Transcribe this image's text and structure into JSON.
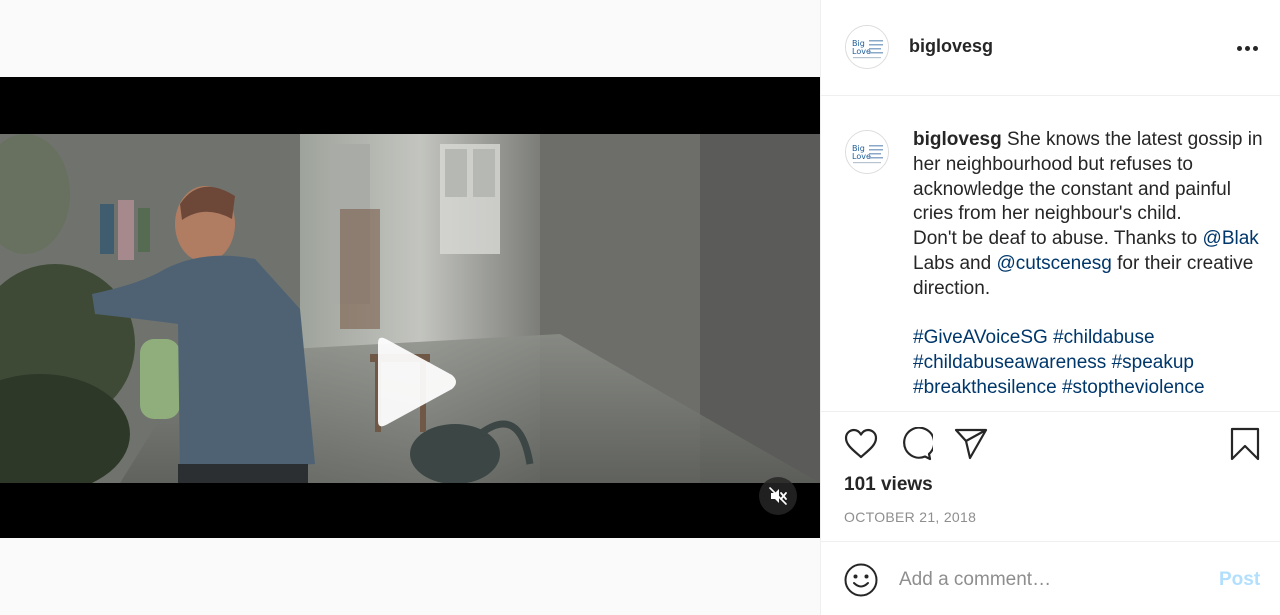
{
  "post": {
    "username": "biglovesg",
    "caption": {
      "username": "biglovesg",
      "text1": " She knows the latest gossip in her neighbourhood but refuses to acknowledge the constant and painful cries from her neighbour's child.",
      "text2": "Don't be deaf to abuse. Thanks to ",
      "mention1": "@Blak",
      "text3": " Labs and ",
      "mention2": "@cutscenesg",
      "text4": " for their creative direction.",
      "hashtags_line1": [
        "#GiveAVoiceSG",
        "#childabuse"
      ],
      "hashtags_line2": [
        "#childabuseawareness",
        "#speakup"
      ],
      "hashtags_line3": [
        "#breakthesilence",
        "#stoptheviolence"
      ]
    },
    "views": "101 views",
    "date": "OCTOBER 21, 2018"
  },
  "avatar_logo": {
    "line1": "Big",
    "line2": "Love"
  },
  "comment": {
    "placeholder": "Add a comment…",
    "post_label": "Post"
  },
  "icons": {
    "more": "more-options-icon",
    "like": "heart-icon",
    "comment": "comment-bubble-icon",
    "share": "paper-plane-icon",
    "save": "bookmark-icon",
    "emoji": "smiley-icon",
    "play": "play-icon",
    "mute": "speaker-muted-icon"
  },
  "colors": {
    "link": "#00376b",
    "post_button_disabled": "#b2dffc",
    "muted_text": "#8e8e8e"
  }
}
